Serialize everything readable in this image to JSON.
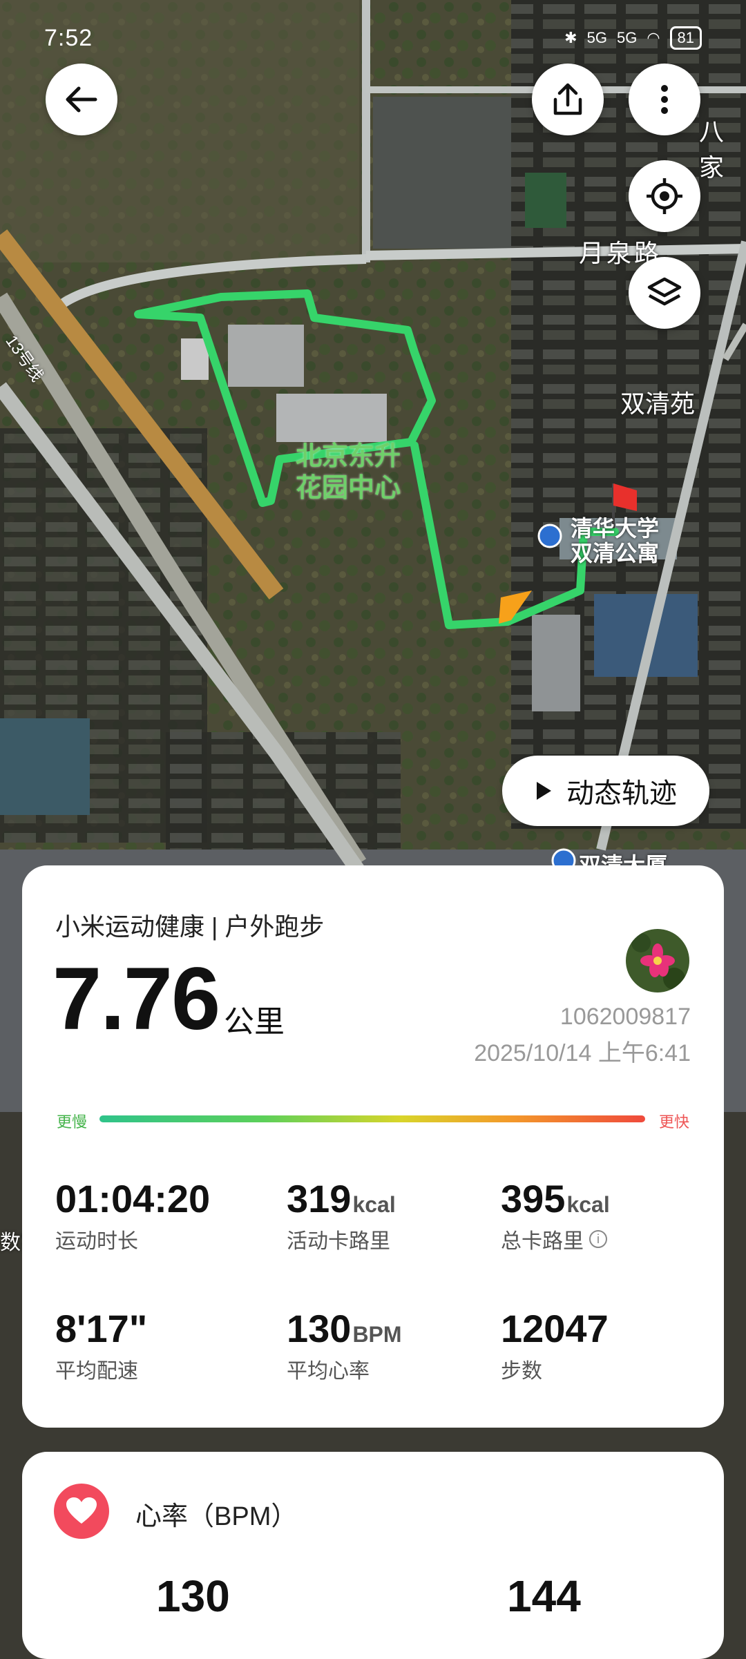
{
  "status_bar": {
    "time": "7:52",
    "signal1": "5G",
    "signal2": "5G",
    "battery": "81"
  },
  "map": {
    "labels": {
      "road_yuequan": "月泉路",
      "shuangqingyuan": "双清苑",
      "bajia": "八家",
      "garden_line1": "北京东升",
      "garden_line2": "花园中心",
      "tsinghua_line1": "清华大学",
      "tsinghua_line2": "双清公寓",
      "shuangqing_building": "双清大厦",
      "line13": "13号线",
      "left_edge": "数字"
    },
    "colors": {
      "route": "#36d46a",
      "start": "#f7a11a",
      "flag": "#e8302c"
    }
  },
  "replay_button": {
    "label": "动态轨迹"
  },
  "workout": {
    "source": "小米运动健康 | 户外跑步",
    "distance": "7.76",
    "distance_unit": "公里",
    "user_id": "1062009817",
    "datetime": "2025/10/14 上午6:41",
    "pace_slow_label": "更慢",
    "pace_fast_label": "更快",
    "stats": [
      {
        "value": "01:04:20",
        "unit": "",
        "label": "运动时长"
      },
      {
        "value": "319",
        "unit": "kcal",
        "label": "活动卡路里"
      },
      {
        "value": "395",
        "unit": "kcal",
        "label": "总卡路里"
      },
      {
        "value": "8'17\"",
        "unit": "",
        "label": "平均配速"
      },
      {
        "value": "130",
        "unit": "BPM",
        "label": "平均心率"
      },
      {
        "value": "12047",
        "unit": "",
        "label": "步数"
      }
    ]
  },
  "heart_rate": {
    "title": "心率（BPM）",
    "avg": "130",
    "max": "144",
    "accent": "#f24a5d"
  }
}
